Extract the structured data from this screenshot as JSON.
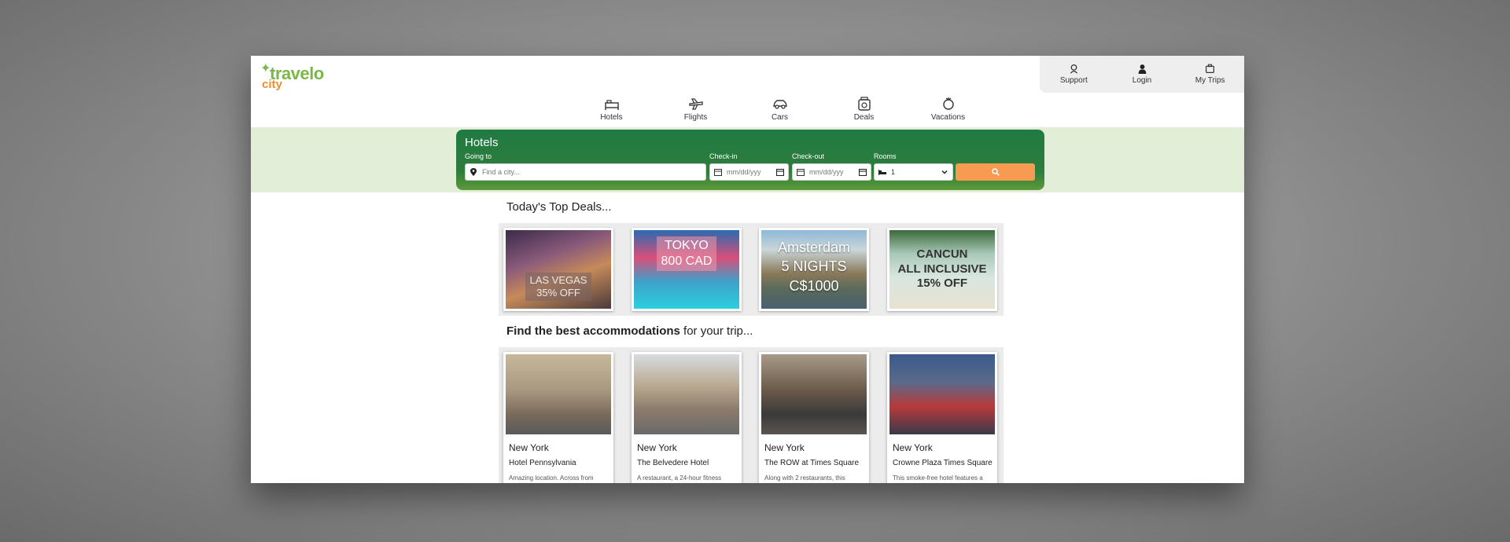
{
  "brand": {
    "name_top": "travelo",
    "name_bottom": "city"
  },
  "top_links": [
    {
      "label": "Support",
      "icon": "support-icon"
    },
    {
      "label": "Login",
      "icon": "user-icon"
    },
    {
      "label": "My Trips",
      "icon": "briefcase-icon"
    }
  ],
  "nav": [
    {
      "label": "Hotels",
      "icon": "hotel-icon"
    },
    {
      "label": "Flights",
      "icon": "plane-icon"
    },
    {
      "label": "Cars",
      "icon": "car-icon"
    },
    {
      "label": "Deals",
      "icon": "deals-icon"
    },
    {
      "label": "Vacations",
      "icon": "vacation-icon"
    }
  ],
  "search": {
    "title": "Hotels",
    "going_to_label": "Going to",
    "going_to_placeholder": "Find a city...",
    "checkin_label": "Check-in",
    "checkin_value": "mm/dd/yyy",
    "checkout_label": "Check-out",
    "checkout_value": "mm/dd/yyy",
    "rooms_label": "Rooms",
    "rooms_value": "1"
  },
  "deals_heading": "Today's Top Deals...",
  "deals": [
    {
      "line1": "LAS VEGAS",
      "line2": "35% OFF",
      "line3": ""
    },
    {
      "line1": "TOKYO",
      "line2": "800 CAD",
      "line3": ""
    },
    {
      "line1": "Amsterdam",
      "line2": "5 NIGHTS",
      "line3": "C$1000"
    },
    {
      "line1": "CANCUN",
      "line2": "ALL INCLUSIVE",
      "line3": "15% OFF"
    }
  ],
  "accom_heading_bold": "Find the best accommodations",
  "accom_heading_rest": " for your trip...",
  "hotels": [
    {
      "city": "New York",
      "name": "Hotel Pennsylvania",
      "desc": "Amazing location. Across from"
    },
    {
      "city": "New York",
      "name": "The Belvedere Hotel",
      "desc": "A restaurant, a 24-hour fitness"
    },
    {
      "city": "New York",
      "name": "The ROW at Times Square",
      "desc": "Along with 2 restaurants, this"
    },
    {
      "city": "New York",
      "name": "Crowne Plaza Times Square",
      "desc": "This smoke-free hotel features a"
    }
  ],
  "colors": {
    "brand_green": "#7ab648",
    "brand_orange": "#f28c2a",
    "search_green": "#2e7d3c",
    "search_button": "#f79a52"
  }
}
